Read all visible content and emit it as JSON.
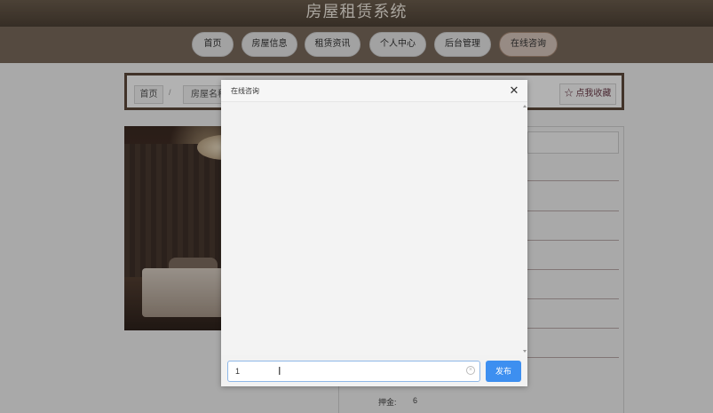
{
  "header": {
    "title": "房屋租赁系统"
  },
  "nav": {
    "items": [
      {
        "label": "首页",
        "active": false
      },
      {
        "label": "房屋信息",
        "active": false
      },
      {
        "label": "租赁资讯",
        "active": false
      },
      {
        "label": "个人中心",
        "active": false
      },
      {
        "label": "后台管理",
        "active": false
      },
      {
        "label": "在线咨询",
        "active": true
      }
    ]
  },
  "breadcrumb": {
    "home": "首页",
    "separator": "/",
    "current": "房屋名称"
  },
  "favorite": {
    "label": "☆ 点我收藏"
  },
  "details": {
    "deposit_label": "押金:",
    "deposit_value": "6"
  },
  "dialog": {
    "title": "在线咨询",
    "close_icon": "close-icon",
    "input_value": "1",
    "send_label": "发布"
  },
  "colors": {
    "accent": "#3d8ff0",
    "header_bg": "#5d4a3b",
    "nav_active": "#d9c8be"
  }
}
